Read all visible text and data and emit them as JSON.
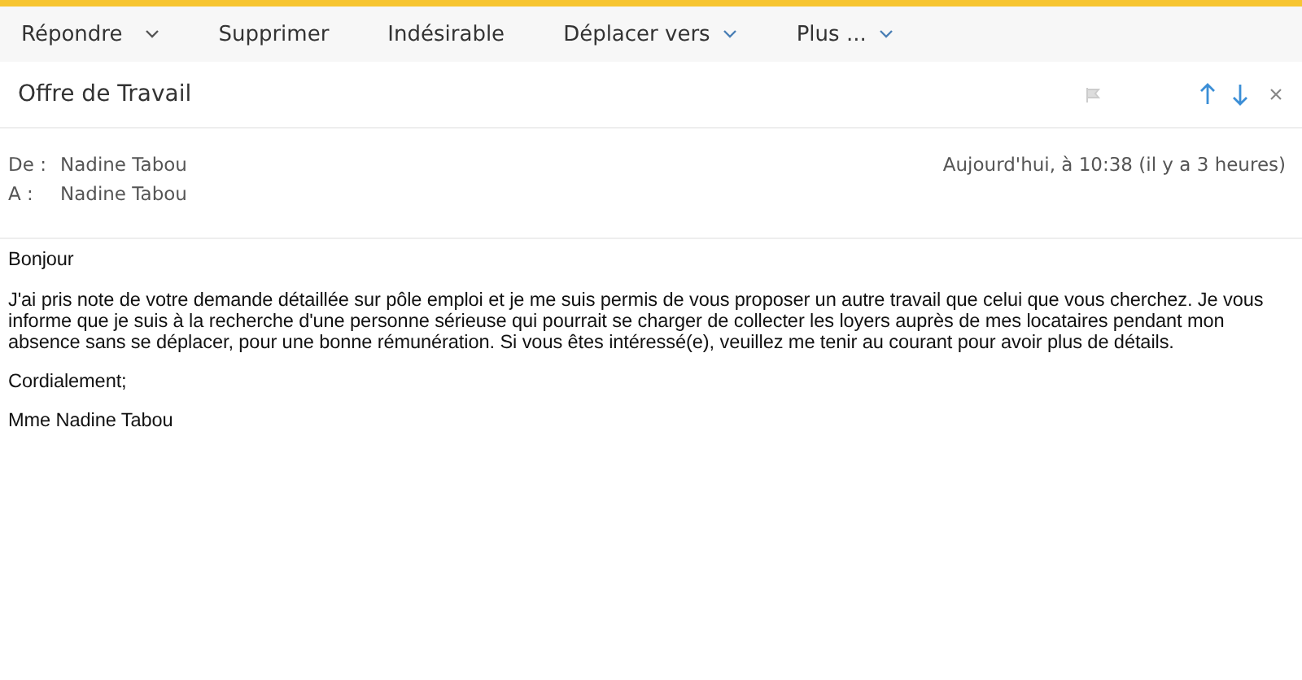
{
  "toolbar": [
    {
      "label": "Répondre",
      "dropdown": true
    },
    {
      "label": "Supprimer",
      "dropdown": false
    },
    {
      "label": "Indésirable",
      "dropdown": false
    },
    {
      "label": "Déplacer vers",
      "dropdown": true
    },
    {
      "label": "Plus ...",
      "dropdown": true
    }
  ],
  "subject": "Offre de Travail",
  "flagged": false,
  "headers": [
    {
      "label": "De :",
      "value": "Nadine Tabou"
    },
    {
      "label": "A :",
      "value": "Nadine Tabou"
    }
  ],
  "date": "Aujourd'hui, à 10:38 (il y a 3 heures)",
  "body": [
    "Bonjour",
    "J'ai pris note de votre demande détaillée sur pôle emploi et je me suis permis de vous proposer un autre travail que celui que vous cherchez. Je vous informe que je suis à la recherche d'une personne sérieuse qui pourrait se charger de collecter les loyers auprès de mes locataires pendant mon absence sans se déplacer, pour une bonne rémunération. Si vous êtes intéressé(e), veuillez me tenir au courant pour avoir plus de détails.",
    "Cordialement;",
    "Mme Nadine Tabou"
  ]
}
